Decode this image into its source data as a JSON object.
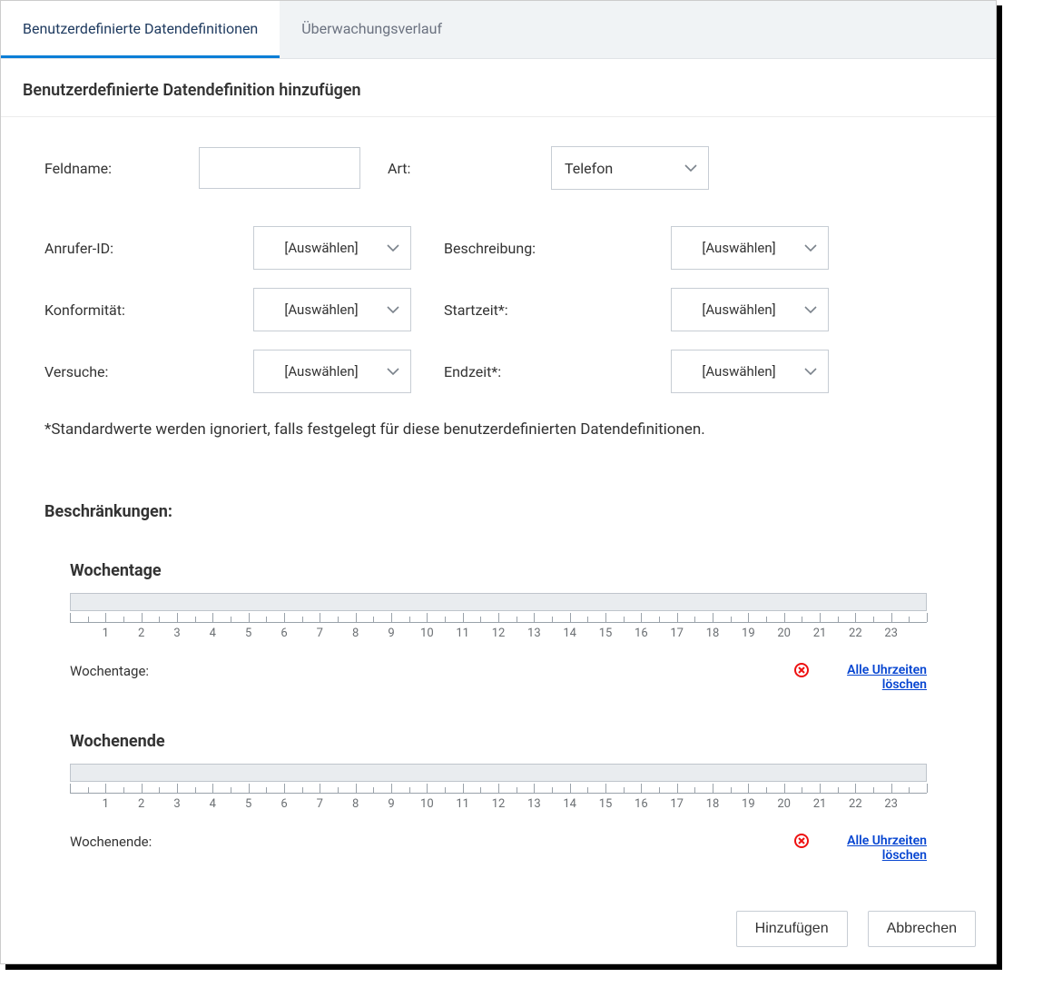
{
  "tabs": {
    "active_label": "Benutzerdefinierte Datendefinitionen",
    "inactive_label": "Überwachungsverlauf"
  },
  "page_title": "Benutzerdefinierte Datendefinition hinzufügen",
  "row1": {
    "fieldname_label": "Feldname:",
    "type_label": "Art:",
    "type_value": "Telefon"
  },
  "grid": {
    "caller_id_label": "Anrufer-ID:",
    "caller_id_value": "[Auswählen]",
    "description_label": "Beschreibung:",
    "description_value": "[Auswählen]",
    "conformity_label": "Konformität:",
    "conformity_value": "[Auswählen]",
    "start_time_label": "Startzeit*:",
    "start_time_value": "[Auswählen]",
    "attempts_label": "Versuche:",
    "attempts_value": "[Auswählen]",
    "end_time_label": "Endzeit*:",
    "end_time_value": "[Auswählen]"
  },
  "note": "*Standardwerte werden ignoriert, falls festgelegt für diese benutzerdefinierten Datendefinitionen.",
  "restrictions_title": "Beschränkungen:",
  "weekdays": {
    "title": "Wochentage",
    "footer_label": "Wochentage:",
    "delete_link": "Alle Uhrzeiten löschen",
    "hours": [
      "1",
      "2",
      "3",
      "4",
      "5",
      "6",
      "7",
      "8",
      "9",
      "10",
      "11",
      "12",
      "13",
      "14",
      "15",
      "16",
      "17",
      "18",
      "19",
      "20",
      "21",
      "22",
      "23"
    ]
  },
  "weekend": {
    "title": "Wochenende",
    "footer_label": "Wochenende:",
    "delete_link": "Alle Uhrzeiten löschen",
    "hours": [
      "1",
      "2",
      "3",
      "4",
      "5",
      "6",
      "7",
      "8",
      "9",
      "10",
      "11",
      "12",
      "13",
      "14",
      "15",
      "16",
      "17",
      "18",
      "19",
      "20",
      "21",
      "22",
      "23"
    ]
  },
  "buttons": {
    "add": "Hinzufügen",
    "cancel": "Abbrechen"
  }
}
